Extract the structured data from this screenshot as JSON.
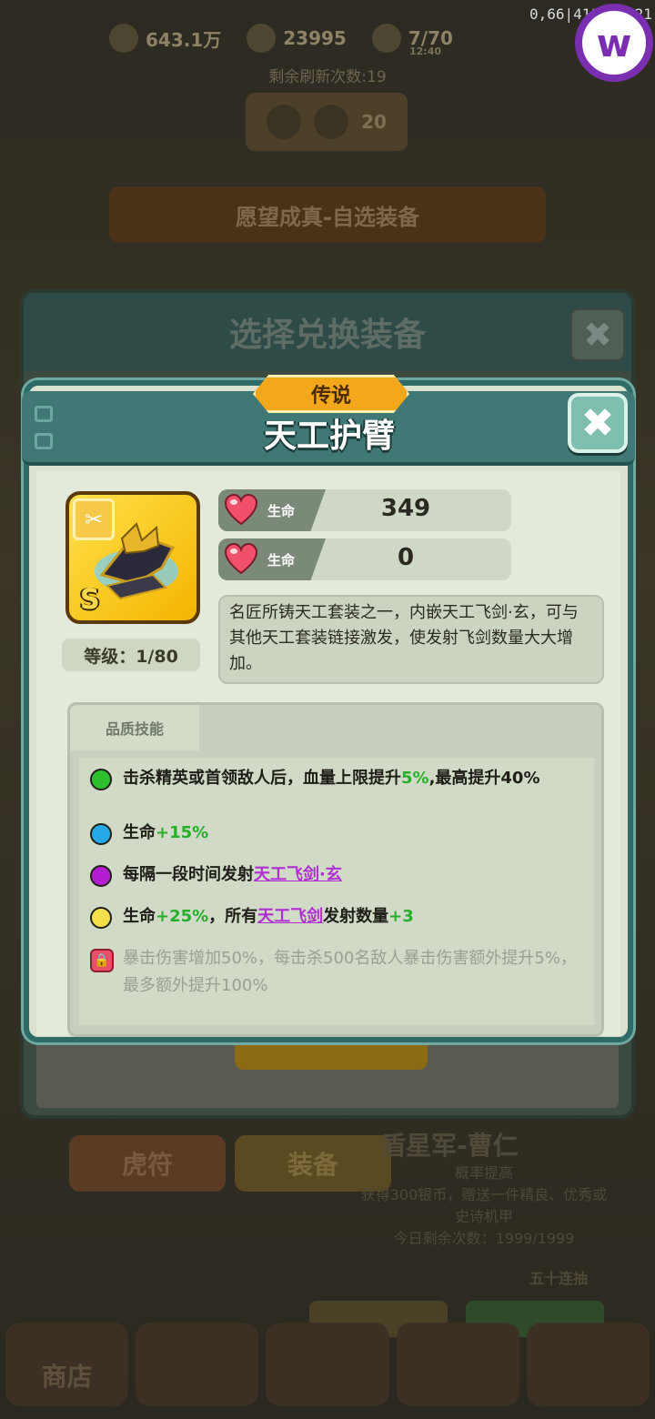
{
  "overlay": {
    "version": "0,66|411815 21",
    "logo_letter": "w"
  },
  "background": {
    "resources": [
      {
        "name": "coin",
        "value": "643.1万"
      },
      {
        "name": "heart",
        "value": "23995"
      },
      {
        "name": "stamina",
        "value": "7/70"
      }
    ],
    "stamina_timer": "12:40",
    "refresh_text": "剩余刷新次数:19",
    "refresh_cost": "20",
    "banner_title": "愿望成真-自选装备",
    "parent_dialog_title": "选择兑换装备",
    "tab_hufu": "虎符",
    "tab_equip": "装备",
    "hero_title": "盾星军-曹仁",
    "hero_line1": "概率提高",
    "hero_line2": "获得300银币，赠送一件精良、优秀或",
    "hero_line3": "史诗机甲",
    "hero_line4": "今日剩余次数：1999/1999",
    "ten_pull": "五十连抽",
    "nav_shop": "商店"
  },
  "dialog": {
    "rarity": "传说",
    "title": "天工护臂",
    "close_icon": "close-icon",
    "item": {
      "grade": "S",
      "level": "等级：1/80"
    },
    "stats": [
      {
        "name": "生命",
        "value": "349"
      },
      {
        "name": "生命",
        "value": "0"
      }
    ],
    "description": "名匠所铸天工套装之一，内嵌天工飞剑·玄，可与其他天工套装链接激发，使发射飞剑数量大大增加。",
    "skills_header": "品质技能",
    "skills": [
      {
        "color": "#2dbf2d",
        "parts": [
          "击杀精英或首领敌人后，血量上限提升",
          "5%",
          ",最高提升40%"
        ]
      },
      {
        "color": "#27a9e8",
        "parts": [
          "生命",
          "+15%"
        ]
      },
      {
        "color": "#b51ed0",
        "parts": [
          "每隔一段时间发射",
          "天工飞剑·玄"
        ]
      },
      {
        "color": "#f2df4a",
        "parts": [
          "生命",
          "+25%",
          "，所有",
          "天工飞剑",
          "发射数量",
          "+3"
        ]
      },
      {
        "locked": true,
        "parts": [
          "暴击伤害增加50%，每击杀500名敌人暴击伤害额外提升5%，最多额外提升100%"
        ]
      }
    ]
  }
}
